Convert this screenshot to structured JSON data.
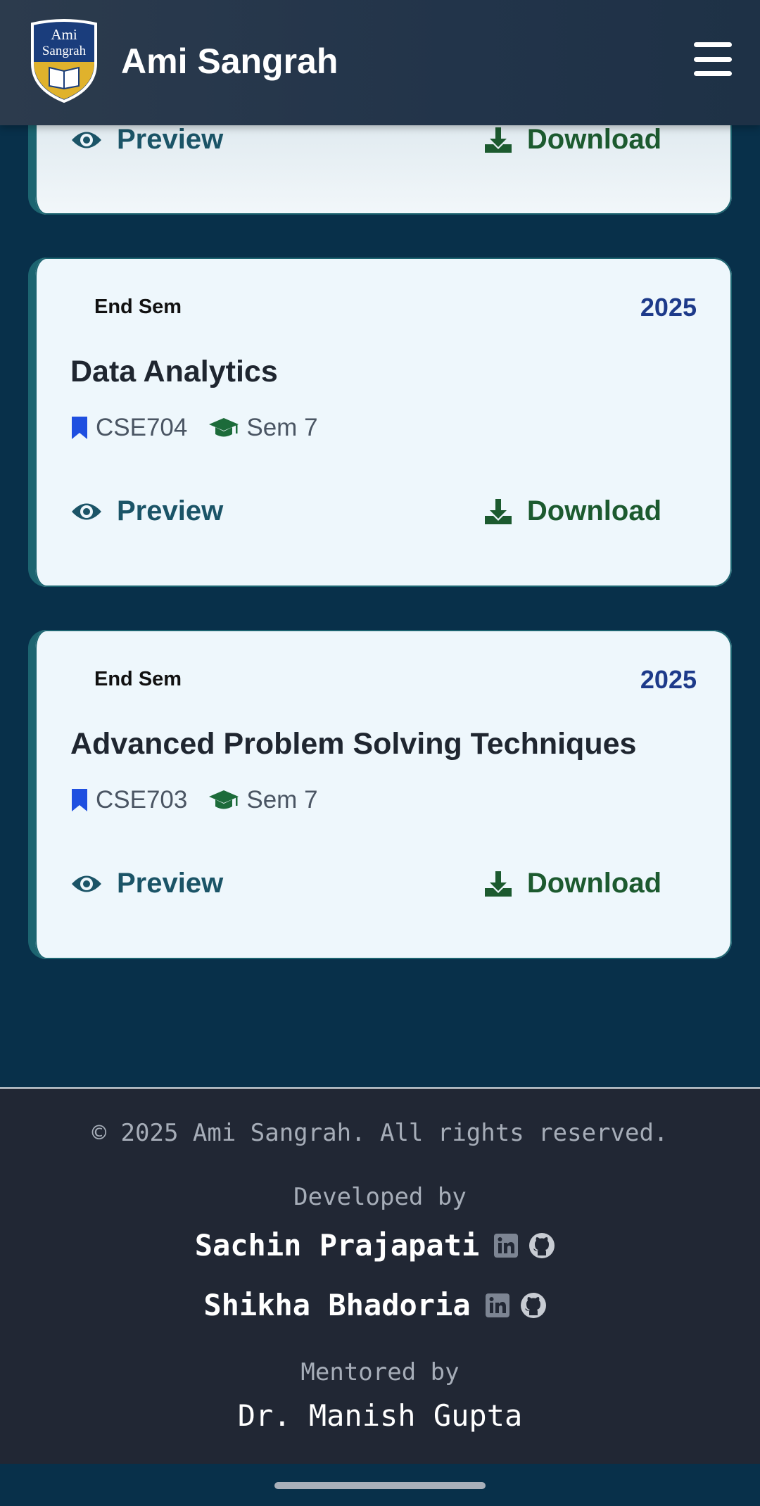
{
  "header": {
    "logo_text_line1": "Ami",
    "logo_text_line2": "Sangrah",
    "title": "Ami Sangrah"
  },
  "papers": [
    {
      "preview_label": "Preview",
      "download_label": "Download"
    },
    {
      "type": "End Sem",
      "year": "2025",
      "title": "Data Analytics",
      "code": "CSE704",
      "semester": "Sem 7",
      "preview_label": "Preview",
      "download_label": "Download"
    },
    {
      "type": "End Sem",
      "year": "2025",
      "title": "Advanced Problem Solving Techniques",
      "code": "CSE703",
      "semester": "Sem 7",
      "preview_label": "Preview",
      "download_label": "Download"
    }
  ],
  "footer": {
    "copyright": "© 2025 Ami Sangrah. All rights reserved.",
    "developed_by_label": "Developed by",
    "developers": [
      {
        "name": "Sachin Prajapati"
      },
      {
        "name": "Shikha Bhadoria"
      }
    ],
    "mentored_by_label": "Mentored by",
    "mentor": "Dr. Manish Gupta"
  },
  "colors": {
    "page_bg": "#08304a",
    "card_bg": "#eef7fc",
    "accent_teal": "#1c6470",
    "year_blue": "#1d3a8a",
    "download_green": "#1c5a2f",
    "footer_bg": "#212734"
  },
  "icons": {
    "preview": "eye-icon",
    "download": "download-icon",
    "code": "bookmark-icon",
    "semester": "graduation-cap-icon",
    "linkedin": "linkedin-icon",
    "github": "github-icon",
    "menu": "hamburger-menu-icon"
  }
}
